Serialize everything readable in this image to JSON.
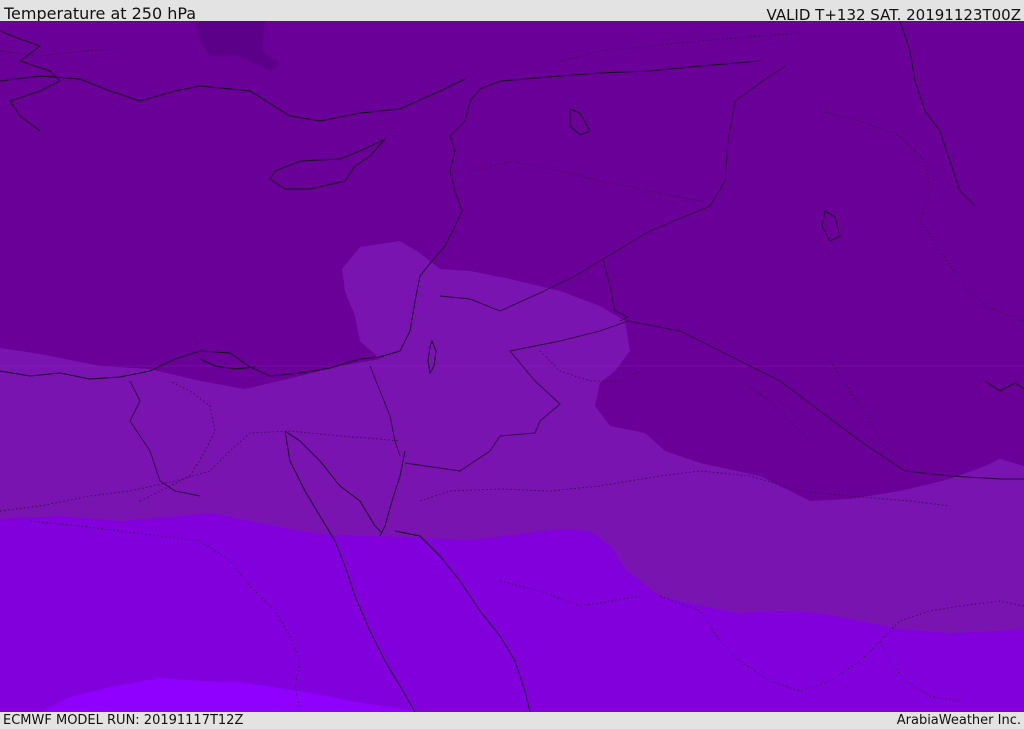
{
  "header": {
    "title": "Temperature at 250 hPa",
    "valid_time": "VALID T+132 SAT. 20191123T00Z"
  },
  "footer": {
    "model_run": "ECMWF MODEL RUN: 20191117T12Z",
    "credit": "ArabiaWeather Inc."
  },
  "map": {
    "colors": {
      "coldest_band": "#5c0089",
      "cold_band": "#6a0097",
      "mid_band": "#7a14b0",
      "warm_band": "#8200dc",
      "warmest_band": "#8f00ff",
      "coastline": "#1a0a22",
      "border": "#2a0a3a"
    }
  }
}
